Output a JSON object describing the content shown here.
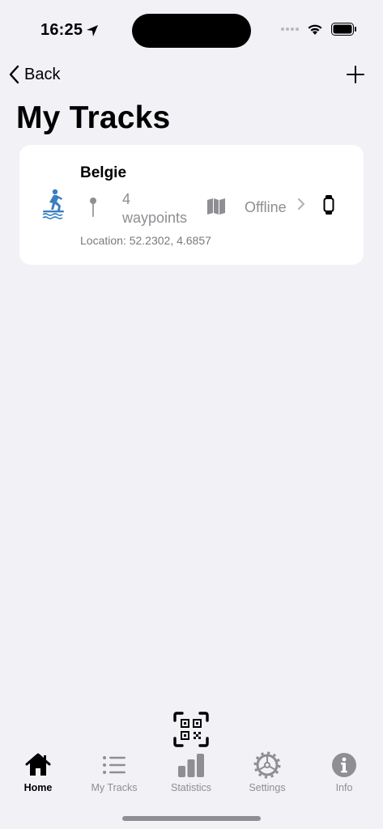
{
  "status_bar": {
    "time": "16:25"
  },
  "nav": {
    "back_label": "Back"
  },
  "page": {
    "title": "My Tracks"
  },
  "tracks": [
    {
      "name": "Belgie",
      "waypoint_count": "4",
      "waypoint_label": "waypoints",
      "map_status": "Offline",
      "location": "Location: 52.2302, 4.6857"
    }
  ],
  "tab_bar": {
    "tabs": [
      {
        "label": "Home",
        "icon": "house-icon",
        "active": true
      },
      {
        "label": "My Tracks",
        "icon": "list-icon",
        "active": false
      },
      {
        "label": "Statistics",
        "icon": "bar-chart-icon",
        "active": false
      },
      {
        "label": "Settings",
        "icon": "gear-icon",
        "active": false
      },
      {
        "label": "Info",
        "icon": "info-icon",
        "active": false
      }
    ]
  },
  "colors": {
    "background": "#f2f1f6",
    "card": "#ffffff",
    "secondary_text": "#8e8e93",
    "activity_icon": "#3a7fc1"
  }
}
